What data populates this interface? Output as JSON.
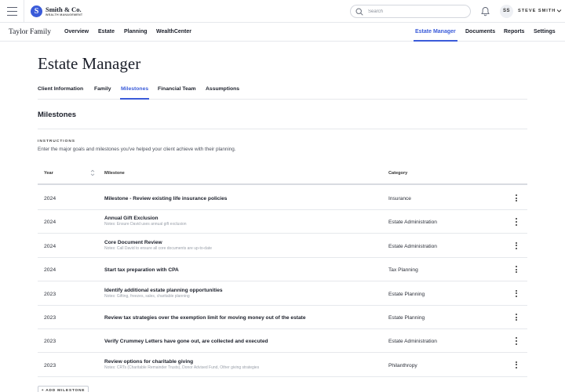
{
  "topbar": {
    "logo_letter": "S",
    "logo_name": "Smith & Co.",
    "logo_sub": "WEALTH MANAGEMENT",
    "search_placeholder": "Search",
    "avatar_initials": "SS",
    "user_name": "STEVE SMITH",
    "icons": [
      "hamburger-icon",
      "search-icon",
      "bell-icon",
      "chevron-down-icon"
    ]
  },
  "navbar": {
    "client_name": "Taylor Family",
    "left_links": [
      "Overview",
      "Estate",
      "Planning",
      "WealthCenter"
    ],
    "right_links": [
      "Estate Manager",
      "Documents",
      "Reports",
      "Settings"
    ],
    "active": "Estate Manager"
  },
  "page": {
    "title": "Estate Manager",
    "tabs": [
      "Client Information",
      "Family",
      "Milestones",
      "Financial Team",
      "Assumptions"
    ],
    "active_tab": "Milestones",
    "section_title": "Milestones",
    "instructions_label": "INSTRUCTIONS",
    "instructions_text": "Enter the major goals and milestones you've helped your client achieve with their planning."
  },
  "table": {
    "headers": {
      "year": "Year",
      "milestone": "Milestone",
      "category": "Category"
    },
    "rows": [
      {
        "year": "2024",
        "milestone": "Milestone - Review existing life insurance policies",
        "note": "",
        "category": "Insurance"
      },
      {
        "year": "2024",
        "milestone": "Annual Gift Exclusion",
        "note": "Notes: Ensure David uses annual gift exclusion",
        "category": "Estate Administration"
      },
      {
        "year": "2024",
        "milestone": "Core Document Review",
        "note": "Notes: Call David to ensure all core documents are up-to-date",
        "category": "Estate Administration"
      },
      {
        "year": "2024",
        "milestone": "Start tax preparation with CPA",
        "note": "",
        "category": "Tax Planning"
      },
      {
        "year": "2023",
        "milestone": "Identify additional estate planning opportunities",
        "note": "Notes: Gifting, freezes, sales, charitable planning",
        "category": "Estate Planning"
      },
      {
        "year": "2023",
        "milestone": "Review tax strategies over the exemption limit for moving money out of the estate",
        "note": "",
        "category": "Estate Planning"
      },
      {
        "year": "2023",
        "milestone": "Verify Crummey Letters have gone out, are collected and executed",
        "note": "",
        "category": "Estate Administration"
      },
      {
        "year": "2023",
        "milestone": "Review options for charitable giving",
        "note": "Notes: CRTs (Charitable Remainder Trusts), Donor Advised Fund, Other giving strategies",
        "category": "Philanthropy"
      }
    ]
  },
  "add_button_label": "+ ADD MILESTONE",
  "colors": {
    "accent": "#3a5bd9",
    "text": "#1b1f2a",
    "muted": "#9aa0aa",
    "border": "#e6e8ec"
  }
}
